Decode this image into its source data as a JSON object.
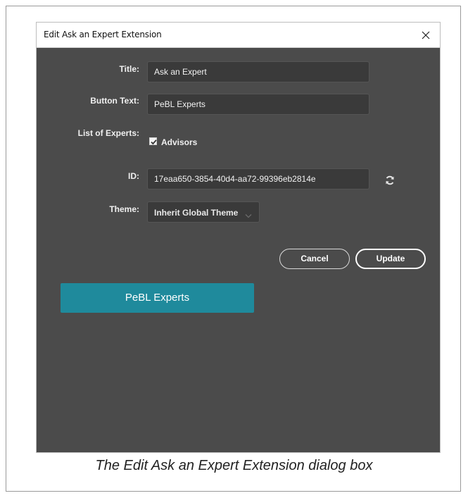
{
  "dialog": {
    "title": "Edit Ask an Expert Extension",
    "close_icon": "close-icon"
  },
  "form": {
    "title_label": "Title:",
    "title_value": "Ask an Expert",
    "button_text_label": "Button Text:",
    "button_text_value": "PeBL Experts",
    "experts_label": "List of Experts:",
    "experts": [
      {
        "label": "Advisors",
        "checked": true
      }
    ],
    "id_label": "ID:",
    "id_value": "17eaa650-3854-40d4-aa72-99396eb2814e",
    "refresh_icon": "refresh-icon",
    "theme_label": "Theme:",
    "theme_selected": "Inherit Global Theme"
  },
  "actions": {
    "cancel_label": "Cancel",
    "update_label": "Update"
  },
  "preview": {
    "button_label": "PeBL Experts",
    "color": "#1f8a9c"
  },
  "caption": "The Edit Ask an Expert Extension dialog box",
  "colors": {
    "dialog_bg": "#4b4b4b",
    "field_bg": "#3a3a3a"
  }
}
